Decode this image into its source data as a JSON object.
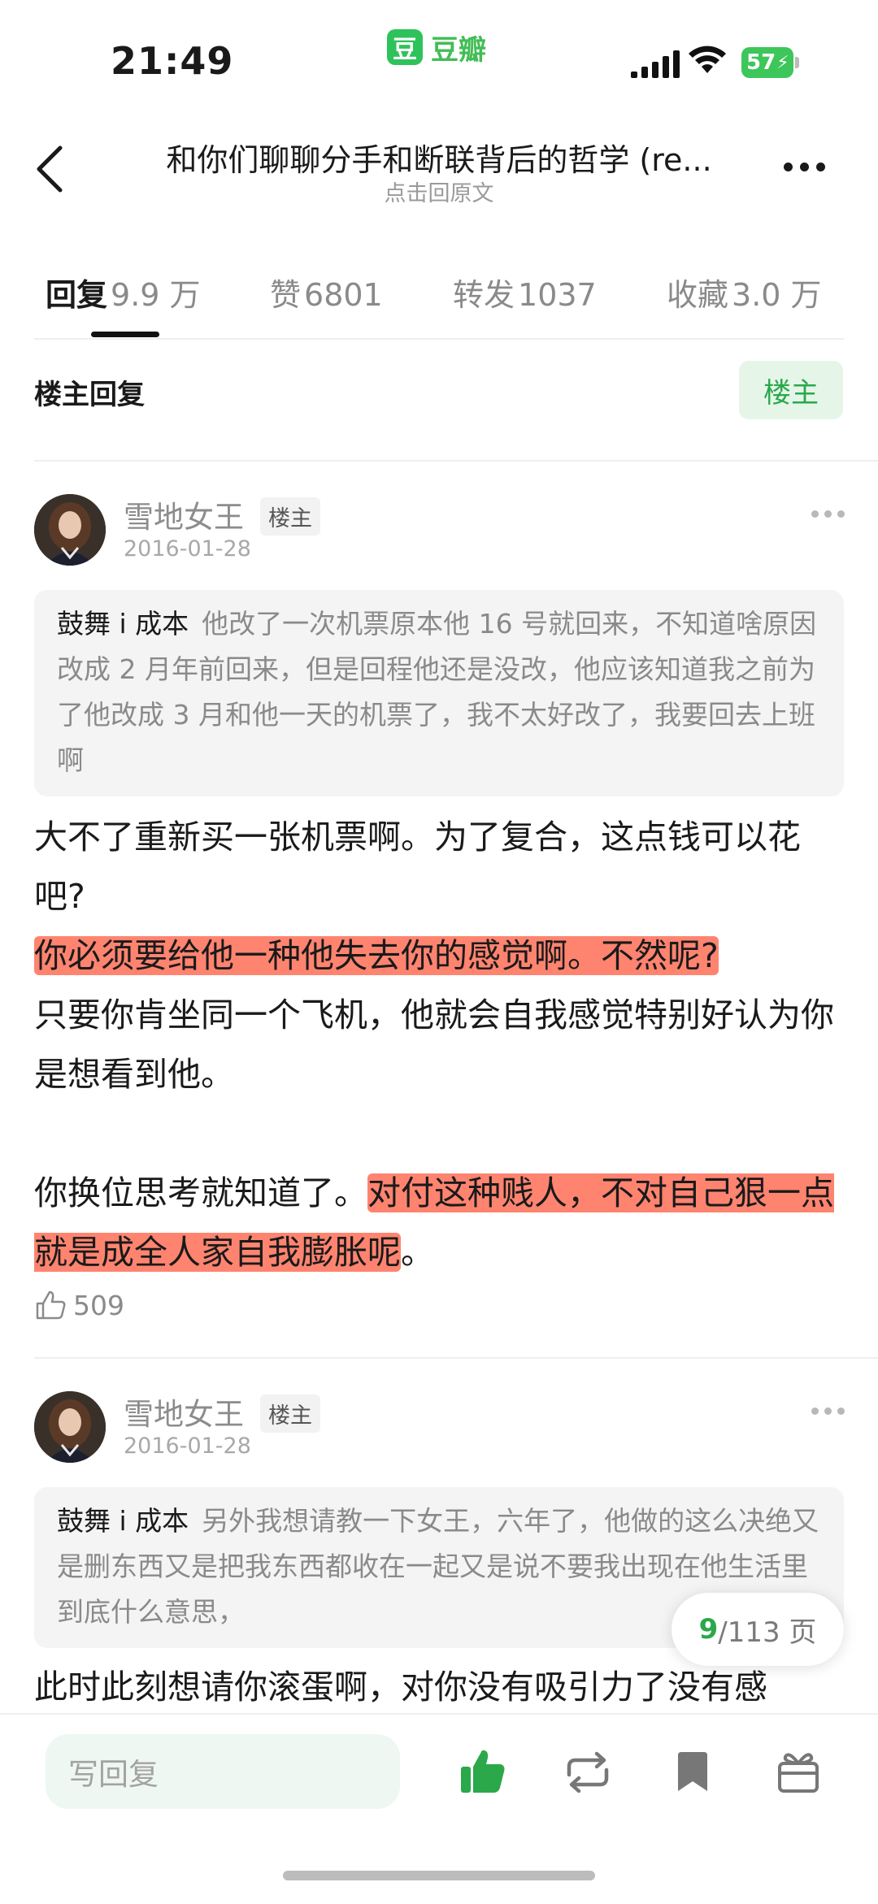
{
  "status_bar": {
    "time": "21:49",
    "app_logo": "豆",
    "app_name": "豆瓣",
    "battery": "57"
  },
  "nav": {
    "title": "和你们聊聊分手和断联背后的哲学 (re...",
    "subtitle": "点击回原文"
  },
  "tabs": [
    {
      "label": "回复",
      "count": "9.9 万"
    },
    {
      "label": "赞",
      "count": "6801"
    },
    {
      "label": "转发",
      "count": "1037"
    },
    {
      "label": "收藏",
      "count": "3.0 万"
    }
  ],
  "filter": {
    "label": "楼主回复",
    "button": "楼主"
  },
  "comments": [
    {
      "author": "雪地女王",
      "badge": "楼主",
      "date": "2016-01-28",
      "quote_author": "鼓舞 i 成本",
      "quote_text": "他改了一次机票原本他 16 号就回来，不知道啥原因改成 2 月年前回来，但是回程他还是没改，他应该知道我之前为了他改成 3 月和他一天的机票了，我不太好改了，我要回去上班啊",
      "line1": "大不了重新买一张机票啊。为了复合，这点钱可以花吧?",
      "highlight1": "你必须要给他一种他失去你的感觉啊。不然呢?",
      "line2": "只要你肯坐同一个飞机，他就会自我感觉特别好认为你是想看到他。",
      "line3_pre": "你换位思考就知道了。",
      "highlight2": "对付这种贱人，不对自己狠一点就是成全人家自我膨胀呢",
      "line3_post": "。",
      "likes": "509"
    },
    {
      "author": "雪地女王",
      "badge": "楼主",
      "date": "2016-01-28",
      "quote_author": "鼓舞 i 成本",
      "quote_text": "另外我想请教一下女王，六年了，他做的这么决绝又是删东西又是把我东西都收在一起又是说不要我出现在他生活里到底什么意思，",
      "line1": "此时此刻想请你滚蛋啊，对你没有吸引力了没有感"
    }
  ],
  "pagination": {
    "current": "9",
    "total": "/113 页"
  },
  "bottom_bar": {
    "reply_placeholder": "写回复"
  },
  "colors": {
    "accent": "#2aa84a",
    "highlight": "#ff8470",
    "brand": "#2ec25b"
  },
  "icons": [
    "back-arrow-icon",
    "more-icon",
    "thumb-up-icon",
    "repost-icon",
    "bookmark-icon",
    "gift-icon",
    "wifi-icon",
    "signal-icon"
  ]
}
